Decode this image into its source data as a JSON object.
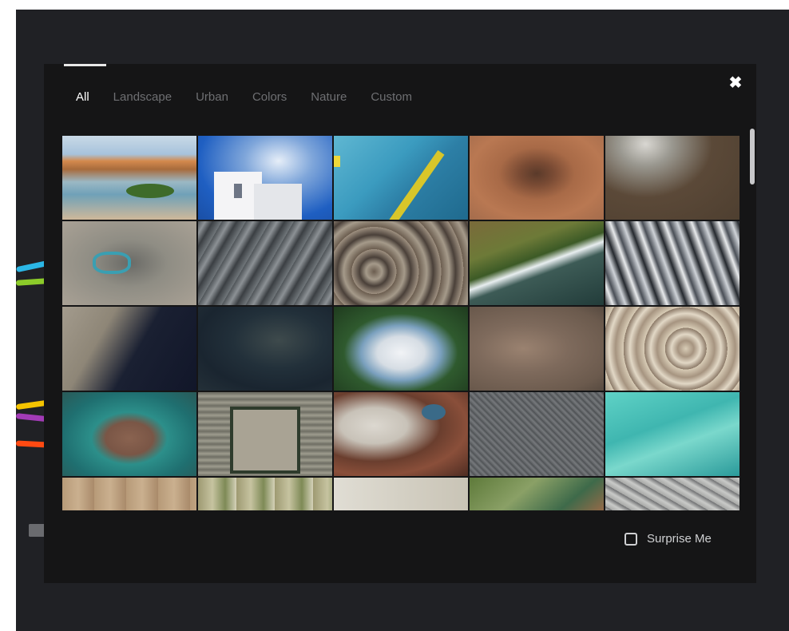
{
  "tabs": [
    {
      "label": "All",
      "active": true
    },
    {
      "label": "Landscape",
      "active": false
    },
    {
      "label": "Urban",
      "active": false
    },
    {
      "label": "Colors",
      "active": false
    },
    {
      "label": "Nature",
      "active": false
    },
    {
      "label": "Custom",
      "active": false
    }
  ],
  "close": {
    "icon": "close-icon",
    "glyph": "✖"
  },
  "surprise": {
    "label": "Surprise Me",
    "checked": false
  },
  "stray_colors": [
    "#2bb7e6",
    "#8ccb2a",
    "#f5c400",
    "#a23bb6",
    "#ff4a12"
  ],
  "thumbnails": [
    "coastal-beach",
    "white-building-sky",
    "teal-geometric",
    "red-desert-rock",
    "mountain-snow",
    "industrial-site",
    "grey-mountains",
    "plateau-terrain",
    "green-coastline",
    "snowy-peaks",
    "dark-coast",
    "dark-bay",
    "snow-volcano",
    "brown-plain",
    "tan-hills",
    "lagoon-city",
    "grid-fortress",
    "salt-lake",
    "city-grid",
    "turquoise-reef",
    "dry-fields",
    "farmland",
    "sand-plain",
    "green-delta",
    "city-sprawl"
  ]
}
